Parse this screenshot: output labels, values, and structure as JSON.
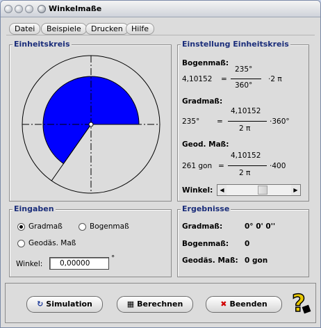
{
  "window": {
    "title": "Winkelmaße"
  },
  "menu": [
    "Datei",
    "Beispiele",
    "Drucken",
    "Hilfe"
  ],
  "unit_circle": {
    "legend": "Einheitskreis",
    "angle_deg": 235,
    "fill_color": "#0000ff"
  },
  "settings": {
    "legend": "Einstellung Einheitskreis",
    "bogenmass_label": "Bogenmaß:",
    "bogenmass_value": "4,10152",
    "bogen_eq": "=",
    "bogen_num": "235°",
    "bogen_den": "360°",
    "bogen_factor": "·2 π",
    "gradmass_label": "Gradmaß:",
    "grad_value": "235°",
    "grad_eq": "=",
    "grad_num": "4,10152",
    "grad_den": "2 π",
    "grad_factor": "·360°",
    "geod_label": "Geod. Maß:",
    "geod_value": "261 gon",
    "geod_eq": "=",
    "geod_num": "4,10152",
    "geod_den": "2 π",
    "geod_factor": "·400",
    "winkel_label": "Winkel:",
    "scroll_position": 0.57
  },
  "inputs": {
    "legend": "Eingaben",
    "options": [
      "Gradmaß",
      "Bogenmaß",
      "Geodäs. Maß"
    ],
    "selected": "Gradmaß",
    "winkel_label": "Winkel:",
    "winkel_value": "0,00000",
    "unit": "°"
  },
  "results": {
    "legend": "Ergebnisse",
    "grad_label": "Gradmaß:",
    "grad_value": "0° 0' 0''",
    "bogen_label": "Bogenmaß:",
    "bogen_value": "0",
    "geod_label": "Geodäs. Maß:",
    "geod_value": "0 gon"
  },
  "buttons": {
    "simulation": "Simulation",
    "berechnen": "Berechnen",
    "beenden": "Beenden"
  }
}
